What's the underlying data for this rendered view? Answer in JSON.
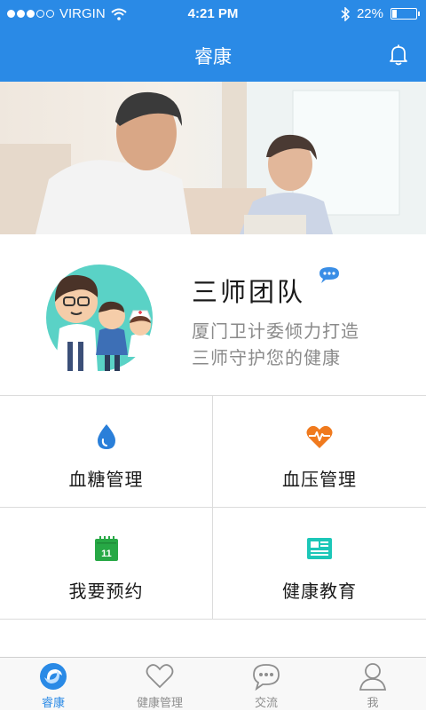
{
  "status_bar": {
    "carrier": "VIRGIN",
    "time": "4:21 PM",
    "battery": "22%",
    "signal_bars_filled": 3,
    "signal_bars_total": 5,
    "battery_level": 0.22
  },
  "nav": {
    "title": "睿康",
    "bell_icon": "bell-icon"
  },
  "intro": {
    "title": "三师团队",
    "line1": "厦门卫计委倾力打造",
    "line2": "三师守护您的健康"
  },
  "features": [
    {
      "label": "血糖管理",
      "icon": "water-drop-icon",
      "color": "#2a7fd9"
    },
    {
      "label": "血压管理",
      "icon": "heart-pulse-icon",
      "color": "#f07a1e"
    },
    {
      "label": "我要预约",
      "icon": "calendar-icon",
      "color": "#27a845",
      "day": "11"
    },
    {
      "label": "健康教育",
      "icon": "news-icon",
      "color": "#1cc7b8"
    }
  ],
  "tabs": [
    {
      "label": "睿康",
      "active": true
    },
    {
      "label": "健康管理",
      "active": false
    },
    {
      "label": "交流",
      "active": false
    },
    {
      "label": "我",
      "active": false
    }
  ],
  "colors": {
    "primary": "#2a8ae6",
    "divider": "#dcdcdc",
    "inactive_tab": "#8e8e8e"
  }
}
